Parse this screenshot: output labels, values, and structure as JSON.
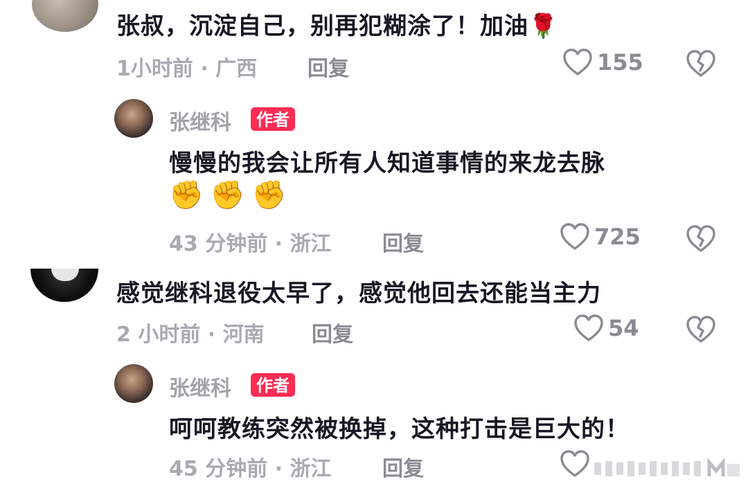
{
  "comments": [
    {
      "text": "张叔，沉淀自己，别再犯糊涂了！加油",
      "emoji": "🌹",
      "time": "1小时前 · 广西",
      "reply_label": "回复",
      "likes": "155",
      "reply": {
        "author": "张继科",
        "badge": "作者",
        "text": "慢慢的我会让所有人知道事情的来龙去脉",
        "emojis": [
          "✊",
          "✊",
          "✊"
        ],
        "time": "43 分钟前 · 浙江",
        "reply_label": "回复",
        "likes": "725"
      }
    },
    {
      "text": "感觉继科退役太早了，感觉他回去还能当主力",
      "time": "2 小时前 · 河南",
      "reply_label": "回复",
      "likes": "54",
      "reply": {
        "author": "张继科",
        "badge": "作者",
        "text": "呵呵教练突然被换掉，这种打击是巨大的！",
        "time": "45 分钟前 · 浙江",
        "reply_label": "回复"
      }
    }
  ],
  "icons": {
    "like": "heart-outline-icon",
    "dislike": "broken-heart-icon"
  },
  "colors": {
    "badge": "#fe2c55",
    "text": "#161823",
    "meta": "#a9aab0"
  }
}
